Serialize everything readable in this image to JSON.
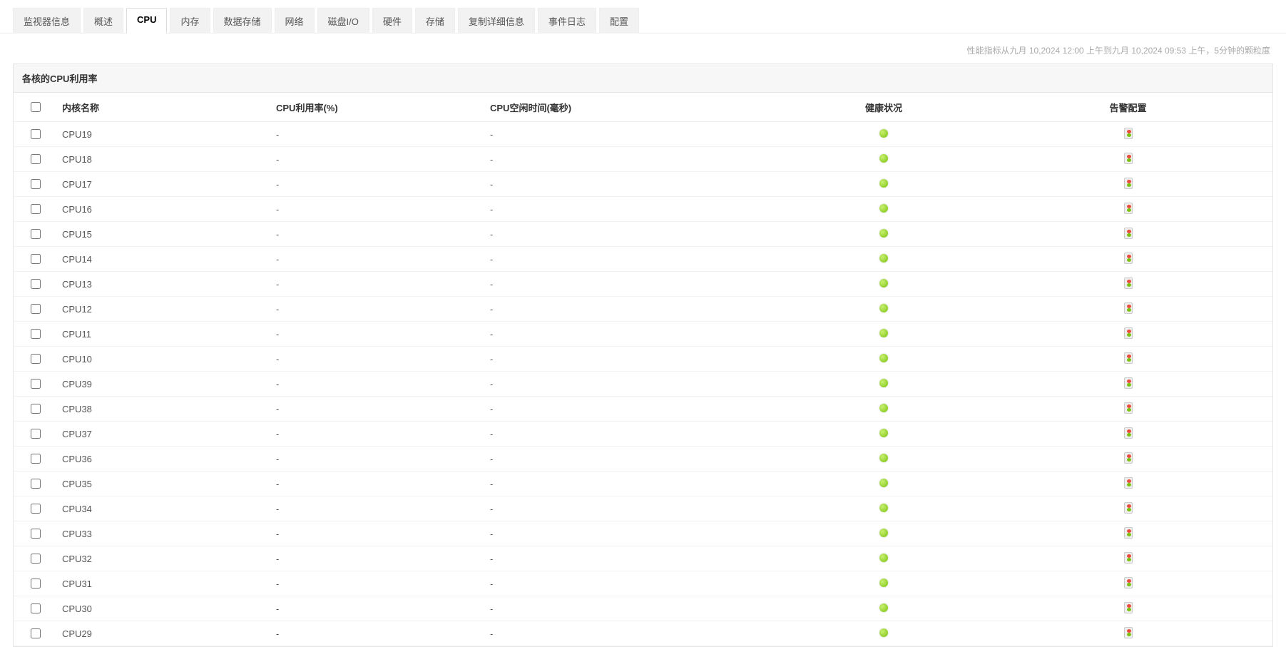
{
  "tabs": [
    {
      "label": "监视器信息",
      "active": false
    },
    {
      "label": "概述",
      "active": false
    },
    {
      "label": "CPU",
      "active": true
    },
    {
      "label": "内存",
      "active": false
    },
    {
      "label": "数据存储",
      "active": false
    },
    {
      "label": "网络",
      "active": false
    },
    {
      "label": "磁盘I/O",
      "active": false
    },
    {
      "label": "硬件",
      "active": false
    },
    {
      "label": "存储",
      "active": false
    },
    {
      "label": "复制详细信息",
      "active": false
    },
    {
      "label": "事件日志",
      "active": false
    },
    {
      "label": "配置",
      "active": false
    }
  ],
  "meta_text": "性能指标从九月 10,2024 12:00 上午到九月 10,2024 09:53 上午，5分钟的颗粒度",
  "panel_title": "各核的CPU利用率",
  "columns": {
    "name": "内核名称",
    "util": "CPU利用率(%)",
    "idle": "CPU空闲时间(毫秒)",
    "health": "健康状况",
    "alert": "告警配置"
  },
  "rows": [
    {
      "name": "CPU19",
      "util": "-",
      "idle": "-",
      "health": "green"
    },
    {
      "name": "CPU18",
      "util": "-",
      "idle": "-",
      "health": "green"
    },
    {
      "name": "CPU17",
      "util": "-",
      "idle": "-",
      "health": "green"
    },
    {
      "name": "CPU16",
      "util": "-",
      "idle": "-",
      "health": "green"
    },
    {
      "name": "CPU15",
      "util": "-",
      "idle": "-",
      "health": "green"
    },
    {
      "name": "CPU14",
      "util": "-",
      "idle": "-",
      "health": "green"
    },
    {
      "name": "CPU13",
      "util": "-",
      "idle": "-",
      "health": "green"
    },
    {
      "name": "CPU12",
      "util": "-",
      "idle": "-",
      "health": "green"
    },
    {
      "name": "CPU11",
      "util": "-",
      "idle": "-",
      "health": "green"
    },
    {
      "name": "CPU10",
      "util": "-",
      "idle": "-",
      "health": "green"
    },
    {
      "name": "CPU39",
      "util": "-",
      "idle": "-",
      "health": "green"
    },
    {
      "name": "CPU38",
      "util": "-",
      "idle": "-",
      "health": "green"
    },
    {
      "name": "CPU37",
      "util": "-",
      "idle": "-",
      "health": "green"
    },
    {
      "name": "CPU36",
      "util": "-",
      "idle": "-",
      "health": "green"
    },
    {
      "name": "CPU35",
      "util": "-",
      "idle": "-",
      "health": "green"
    },
    {
      "name": "CPU34",
      "util": "-",
      "idle": "-",
      "health": "green"
    },
    {
      "name": "CPU33",
      "util": "-",
      "idle": "-",
      "health": "green"
    },
    {
      "name": "CPU32",
      "util": "-",
      "idle": "-",
      "health": "green"
    },
    {
      "name": "CPU31",
      "util": "-",
      "idle": "-",
      "health": "green"
    },
    {
      "name": "CPU30",
      "util": "-",
      "idle": "-",
      "health": "green"
    },
    {
      "name": "CPU29",
      "util": "-",
      "idle": "-",
      "health": "green"
    }
  ]
}
